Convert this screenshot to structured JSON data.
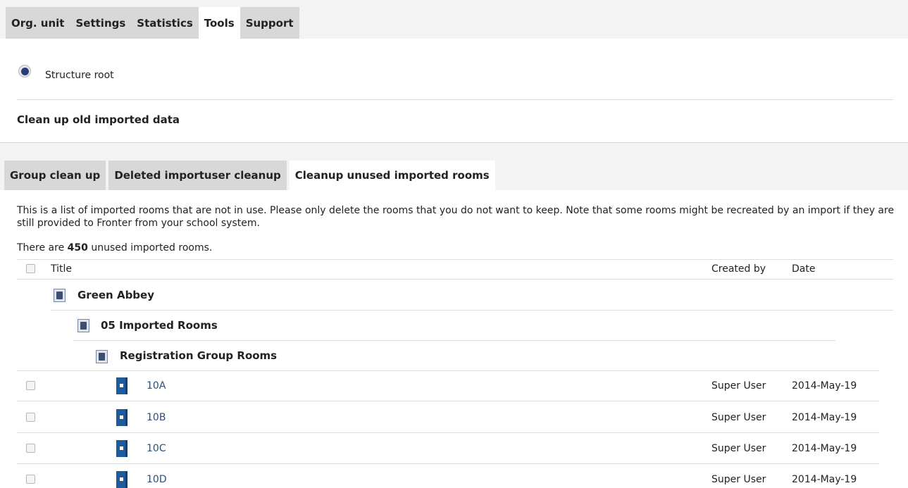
{
  "top_tabs": [
    {
      "label": "Org. unit",
      "active": false
    },
    {
      "label": "Settings",
      "active": false
    },
    {
      "label": "Statistics",
      "active": false
    },
    {
      "label": "Tools",
      "active": true
    },
    {
      "label": "Support",
      "active": false
    }
  ],
  "structure": {
    "root_label": "Structure root"
  },
  "cleanup_title": "Clean up old imported data",
  "sub_tabs": [
    {
      "label": "Group clean up",
      "active": false
    },
    {
      "label": "Deleted importuser cleanup",
      "active": false
    },
    {
      "label": "Cleanup unused imported rooms",
      "active": true
    }
  ],
  "description": "This is a list of imported rooms that are not in use. Please only delete the rooms that you do not want to keep. Note that some rooms might be recreated by an import if they are still provided to Fronter from your school system.",
  "count": {
    "prefix": "There are",
    "number": "450",
    "suffix": "unused imported rooms."
  },
  "table": {
    "headers": {
      "title": "Title",
      "created_by": "Created by",
      "date": "Date"
    },
    "groups": [
      "Green Abbey",
      "05 Imported Rooms",
      "Registration Group Rooms"
    ],
    "rows": [
      {
        "name": "10A",
        "created_by": "Super User",
        "date": "2014-May-19"
      },
      {
        "name": "10B",
        "created_by": "Super User",
        "date": "2014-May-19"
      },
      {
        "name": "10C",
        "created_by": "Super User",
        "date": "2014-May-19"
      },
      {
        "name": "10D",
        "created_by": "Super User",
        "date": "2014-May-19"
      }
    ]
  },
  "colors": {
    "accent": "#1d5b9c",
    "tab_inactive": "#d8d8d8",
    "background": "#f3f3f3"
  }
}
